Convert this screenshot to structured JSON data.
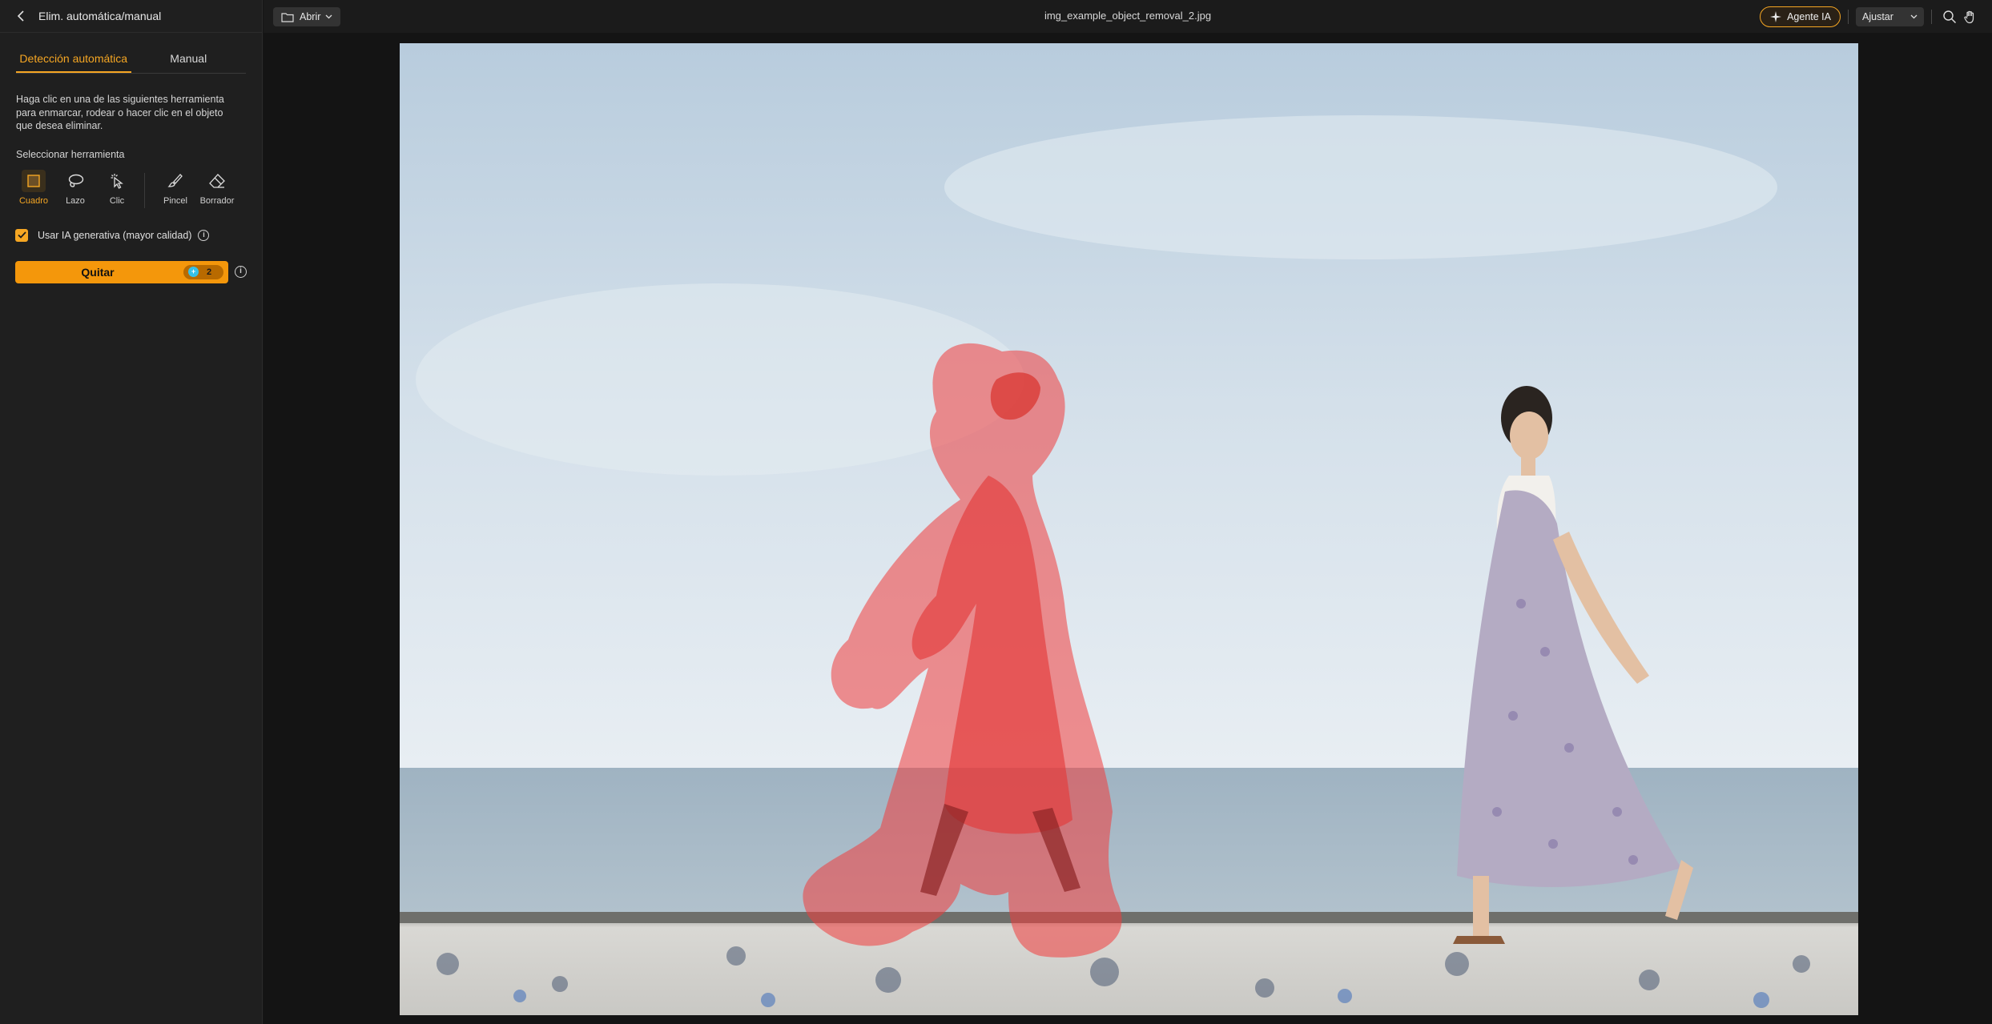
{
  "sidebar": {
    "title": "Elim. automática/manual",
    "tabs": [
      {
        "label": "Detección automática",
        "active": true
      },
      {
        "label": "Manual",
        "active": false
      }
    ],
    "description": "Haga clic en una de las siguientes herramienta para enmarcar, rodear o hacer clic en el objeto que desea eliminar.",
    "select_tool_label": "Seleccionar herramienta",
    "tools": [
      {
        "label": "Cuadro",
        "icon": "box-select-icon",
        "active": true
      },
      {
        "label": "Lazo",
        "icon": "lasso-icon",
        "active": false
      },
      {
        "label": "Clic",
        "icon": "click-select-icon",
        "active": false
      },
      {
        "label": "Pincel",
        "icon": "brush-icon",
        "active": false
      },
      {
        "label": "Borrador",
        "icon": "eraser-icon",
        "active": false
      }
    ],
    "generative_ai": {
      "label": "Usar IA generativa (mayor calidad)",
      "checked": true
    },
    "remove_button": {
      "label": "Quitar",
      "credits": "2"
    }
  },
  "topbar": {
    "open_label": "Abrir",
    "file_name": "img_example_object_removal_2.jpg",
    "agent_label": "Agente IA",
    "fit_label": "Ajustar"
  },
  "colors": {
    "accent": "#f5a623",
    "button": "#f4970b",
    "mask": "#f03c3c"
  }
}
